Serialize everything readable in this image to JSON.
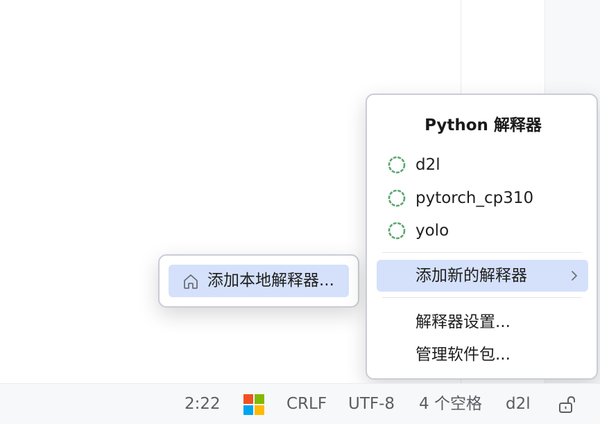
{
  "interpreter_popup": {
    "title": "Python 解释器",
    "interpreters": [
      {
        "label": "d2l",
        "icon": "conda-env-icon"
      },
      {
        "label": "pytorch_cp310",
        "icon": "conda-env-icon"
      },
      {
        "label": "yolo",
        "icon": "conda-env-icon"
      }
    ],
    "add_new_label": "添加新的解释器",
    "settings_label": "解释器设置...",
    "manage_packages_label": "管理软件包..."
  },
  "submenu": {
    "add_local_label": "添加本地解释器...",
    "icon": "home-icon"
  },
  "status_bar": {
    "position": "2:22",
    "line_separator": "CRLF",
    "encoding": "UTF-8",
    "indent": "4 个空格",
    "interpreter": "d2l",
    "os_icon": "windows-logo-icon",
    "lock_icon": "unlocked-icon"
  },
  "colors": {
    "accent_selected": "#d5e1fb",
    "env_icon": "#5aa86f",
    "status_bg": "#f7f8fa"
  }
}
